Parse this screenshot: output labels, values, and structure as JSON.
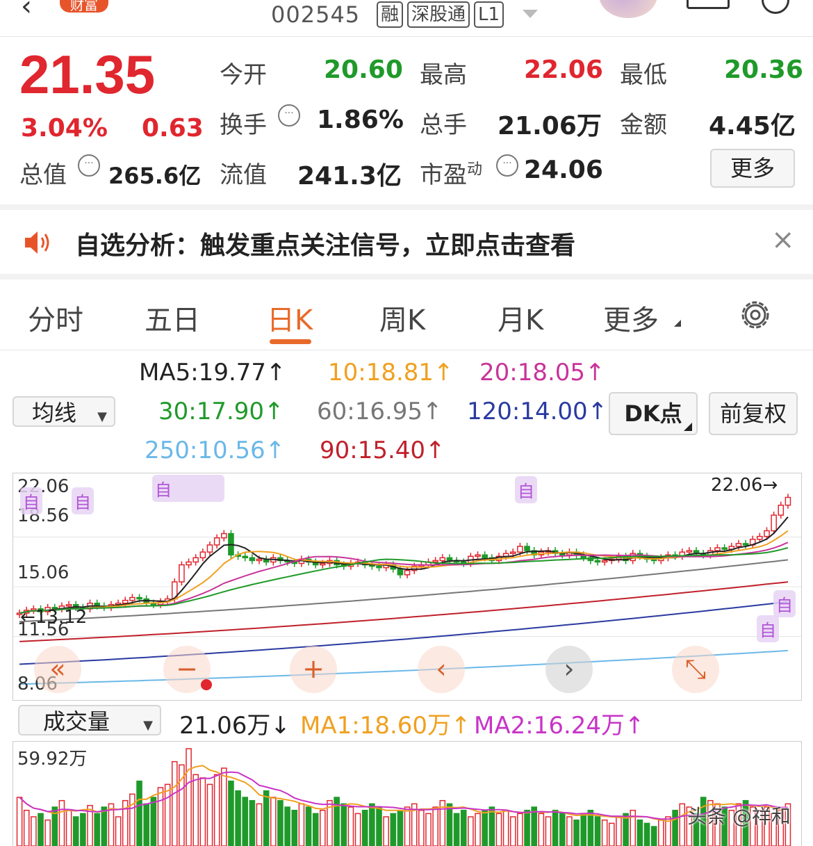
{
  "header": {
    "badge": "财富",
    "code": "002545",
    "tags": [
      "融",
      "深股通",
      "L1"
    ]
  },
  "quote": {
    "price": "21.35",
    "change_pct": "3.04%",
    "change": "0.63",
    "stats": [
      {
        "label": "今开",
        "value": "20.60",
        "color": "green"
      },
      {
        "label": "最高",
        "value": "22.06",
        "color": "red"
      },
      {
        "label": "最低",
        "value": "20.36",
        "color": "green"
      },
      {
        "label": "换手",
        "value": "1.86%",
        "color": "black"
      },
      {
        "label": "总手",
        "value": "21.06万",
        "color": "black"
      },
      {
        "label": "金额",
        "value": "4.45亿",
        "color": "black"
      },
      {
        "label": "总值",
        "value": "265.6亿",
        "color": "black"
      },
      {
        "label": "流值",
        "value": "241.3亿",
        "color": "black"
      },
      {
        "label": "市盈",
        "sup": "动",
        "value": "24.06",
        "color": "black"
      }
    ],
    "more_button": "更多"
  },
  "notice": {
    "text": "自选分析：触发重点关注信号，立即点击查看"
  },
  "tabs": [
    "分时",
    "五日",
    "日K",
    "周K",
    "月K",
    "更多"
  ],
  "active_tab": "日K",
  "indicators": {
    "selector": "均线",
    "items": [
      {
        "text": "MA5:19.77",
        "color": "#222222"
      },
      {
        "text": "10:18.81",
        "color": "#f0a020"
      },
      {
        "text": "20:18.05",
        "color": "#c8349a"
      },
      {
        "text": "30:17.90",
        "color": "#1f9a2a"
      },
      {
        "text": "60:16.95",
        "color": "#777777"
      },
      {
        "text": "120:14.00",
        "color": "#2a3aa0"
      },
      {
        "text": "250:10.56",
        "color": "#6ab8e8"
      },
      {
        "text": "90:15.40",
        "color": "#c0202a"
      }
    ],
    "dk_button": "DK点",
    "fq_button": "前复权"
  },
  "kchart": {
    "y_labels": [
      "22.06",
      "18.56",
      "15.06",
      "11.56",
      "8.06"
    ],
    "high_marker": "22.06",
    "low_marker": "13.12",
    "zi_mark": "自",
    "controls": [
      "«",
      "−",
      "+",
      "‹",
      "›",
      "⤡"
    ]
  },
  "volume": {
    "selector": "成交量",
    "current": "21.06万",
    "ma1": "MA1:18.60万",
    "ma2": "MA2:16.24万",
    "max_label": "59.92万",
    "watermark": "头条 @祥和"
  },
  "colors": {
    "up": "#e0262e",
    "down": "#1f9a2a",
    "accent": "#e86a2a"
  },
  "chart_data": {
    "type": "candlestick",
    "ylim": [
      8.06,
      22.06
    ],
    "ma_latest": {
      "MA5": 19.77,
      "MA10": 18.81,
      "MA20": 18.05,
      "MA30": 17.9,
      "MA60": 16.95,
      "MA90": 15.4,
      "MA120": 14.0,
      "MA250": 10.56
    },
    "close_series": [
      13.2,
      13.4,
      13.5,
      13.3,
      13.6,
      13.5,
      13.7,
      13.8,
      13.6,
      13.5,
      13.9,
      13.7,
      13.6,
      13.8,
      13.9,
      14.1,
      14.3,
      14.2,
      13.9,
      13.8,
      14.0,
      14.2,
      15.4,
      16.6,
      16.8,
      17.1,
      17.5,
      18.0,
      18.5,
      18.8,
      17.3,
      17.2,
      17.1,
      16.9,
      17.0,
      16.8,
      17.1,
      16.9,
      16.8,
      16.7,
      17.0,
      16.8,
      16.6,
      16.7,
      16.9,
      16.6,
      16.5,
      16.7,
      16.8,
      16.6,
      16.5,
      16.4,
      16.6,
      16.3,
      15.9,
      16.2,
      16.5,
      16.6,
      16.8,
      16.9,
      17.1,
      16.9,
      16.8,
      16.7,
      17.2,
      17.3,
      17.1,
      16.9,
      17.2,
      17.4,
      17.5,
      17.9,
      17.6,
      17.3,
      17.5,
      17.6,
      17.4,
      17.3,
      17.5,
      17.3,
      17.1,
      16.9,
      16.8,
      16.9,
      17.0,
      17.2,
      16.9,
      17.4,
      17.2,
      17.0,
      16.9,
      17.1,
      17.3,
      17.2,
      17.5,
      17.6,
      17.4,
      17.3,
      17.6,
      17.8,
      17.7,
      17.9,
      18.1,
      18.0,
      18.4,
      18.6,
      19.0,
      20.1,
      20.8,
      21.35
    ],
    "volume_series": [
      30,
      22,
      18,
      20,
      16,
      24,
      28,
      22,
      18,
      20,
      25,
      20,
      24,
      26,
      18,
      28,
      32,
      40,
      26,
      30,
      36,
      38,
      52,
      50,
      60,
      44,
      42,
      38,
      44,
      48,
      40,
      34,
      30,
      28,
      26,
      34,
      30,
      28,
      24,
      22,
      26,
      24,
      20,
      22,
      28,
      30,
      26,
      24,
      20,
      22,
      26,
      24,
      18,
      20,
      22,
      24,
      26,
      22,
      20,
      24,
      28,
      26,
      20,
      22,
      18,
      20,
      22,
      24,
      20,
      22,
      18,
      20,
      22,
      24,
      20,
      18,
      22,
      20,
      18,
      16,
      20,
      22,
      18,
      16,
      14,
      18,
      20,
      22,
      16,
      14,
      12,
      16,
      18,
      22,
      26,
      24,
      20,
      30,
      28,
      26,
      24,
      22,
      26,
      28,
      24,
      22,
      24,
      20,
      22,
      26
    ]
  }
}
